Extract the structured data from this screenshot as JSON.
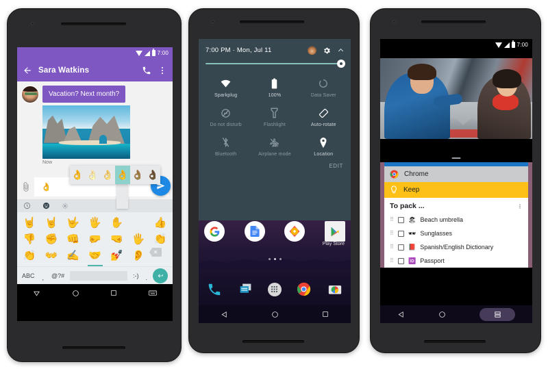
{
  "phone1": {
    "name": "messaging-phone",
    "status_bar": {
      "time": "7:00",
      "icons": [
        "wifi-icon",
        "signal-icon",
        "battery-icon"
      ]
    },
    "app_bar": {
      "back_icon": "back-arrow-icon",
      "title": "Sara Watkins",
      "call_icon": "phone-call-icon",
      "overflow_icon": "more-vertical-icon"
    },
    "conversation": {
      "message_text": "Vacation? Next month?",
      "timestamp": "Now",
      "attachment_icon": "paperclip-icon",
      "send_icon": "send-icon",
      "input_value": "👌"
    },
    "keyboard": {
      "tabs": [
        {
          "icon": "recent-clock-icon",
          "selected": false
        },
        {
          "icon": "emoji-smiley-icon",
          "selected": true
        },
        {
          "icon": "emoji-objects-icon",
          "selected": false
        }
      ],
      "tone_popup": {
        "options": [
          "👌",
          "👌",
          "👌",
          "👌",
          "👌",
          "👌"
        ],
        "selected_index": 3
      },
      "rows": [
        [
          "🤘",
          "🤘",
          "🤟",
          "🖐",
          "✋",
          "👍"
        ],
        [
          "👎",
          "✊",
          "👊",
          "🤛",
          "🤜",
          "🖐",
          "👏"
        ],
        [
          "👏",
          "👐",
          "✍",
          "🤝",
          "💅",
          "👂"
        ]
      ],
      "bottom": {
        "abc_label": "ABC",
        "comma_label": ",",
        "symbols_label": "@?#",
        "emoticon_label": ":-)",
        "period_label": ".",
        "enter_icon": "enter-return-icon",
        "backspace_icon": "backspace-icon"
      }
    },
    "nav_bar": {
      "back": "nav-back-icon",
      "home": "nav-home-icon",
      "recents": "nav-recents-icon",
      "keyboard": "nav-keyboard-icon"
    }
  },
  "phone2": {
    "name": "quick-settings-phone",
    "quick_settings": {
      "datetime": "7:00 PM  ·  Mon, Jul 11",
      "avatar_icon": "user-avatar-icon",
      "settings_icon": "gear-icon",
      "collapse_icon": "chevron-up-icon",
      "brightness_icon": "brightness-icon",
      "brightness_percent": 96,
      "tiles": [
        {
          "label": "Sparkplug",
          "icon": "wifi-icon",
          "state": "on"
        },
        {
          "label": "100%",
          "icon": "battery-icon",
          "state": "on"
        },
        {
          "label": "Data Saver",
          "icon": "data-saver-icon",
          "state": "off"
        },
        {
          "label": "Do not disturb",
          "icon": "do-not-disturb-icon",
          "state": "off"
        },
        {
          "label": "Flashlight",
          "icon": "flashlight-icon",
          "state": "off"
        },
        {
          "label": "Auto-rotate",
          "icon": "auto-rotate-icon",
          "state": "on"
        },
        {
          "label": "Bluetooth",
          "icon": "bluetooth-off-icon",
          "state": "off"
        },
        {
          "label": "Airplane mode",
          "icon": "airplane-mode-icon",
          "state": "off"
        },
        {
          "label": "Location",
          "icon": "location-pin-icon",
          "state": "on"
        }
      ],
      "edit_label": "EDIT"
    },
    "home_screen": {
      "row_icons": [
        "google-icon",
        "docs-icon",
        "music-icon",
        "play-store-icon"
      ],
      "play_store_label": "Play Store",
      "page_dots": 3,
      "active_dot": 1,
      "dock_icons": [
        "phone-icon",
        "messages-icon",
        "app-drawer-icon",
        "chrome-icon",
        "camera-icon"
      ]
    },
    "nav_bar": {
      "back": "nav-back-icon",
      "home": "nav-home-icon",
      "recents": "nav-recents-icon"
    }
  },
  "phone3": {
    "name": "split-screen-phone",
    "status_bar": {
      "time": "7:00",
      "icons": [
        "wifi-icon",
        "signal-icon",
        "battery-icon"
      ]
    },
    "video": {
      "handle_icon": "drag-handle-icon"
    },
    "app_switcher": {
      "chrome": {
        "label": "Chrome",
        "icon": "chrome-icon"
      },
      "keep": {
        "label": "Keep",
        "icon": "keep-bulb-icon"
      }
    },
    "keep_note": {
      "title": "To pack ...",
      "overflow_icon": "more-vertical-icon",
      "items": [
        {
          "emoji": "🏖",
          "text": "Beach umbrella",
          "checked": false
        },
        {
          "emoji": "🕶",
          "text": "Sunglasses",
          "checked": false
        },
        {
          "emoji": "📕",
          "text": "Spanish/English Dictionary",
          "checked": false
        },
        {
          "emoji": "🆔",
          "text": "Passport",
          "checked": false
        }
      ]
    },
    "nav_bar": {
      "back": "nav-back-icon",
      "home": "nav-home-icon",
      "recents": "nav-recents-split-icon"
    }
  },
  "colors": {
    "messaging_purple": "#7e57c2",
    "send_blue": "#1e88e5",
    "quick_settings_slate": "#37474f",
    "keep_yellow": "#fcc016",
    "chrome_blue": "#1b74c4",
    "teal_accent": "#4db6ac"
  }
}
